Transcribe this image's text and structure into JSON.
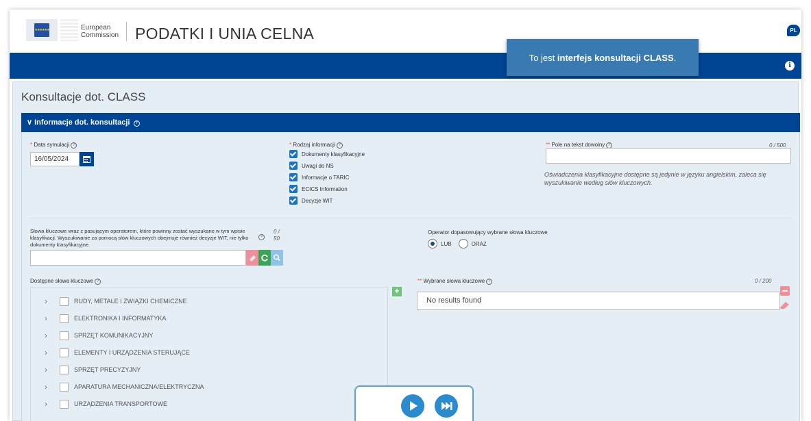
{
  "header": {
    "ec_line1": "European",
    "ec_line2": "Commission",
    "site_title": "PODATKI I UNIA CELNA",
    "lang": "PL",
    "info_icon": "info-icon"
  },
  "tooltip": {
    "prefix": "To jest ",
    "bold": "interfejs konsultacji CLASS",
    "suffix": "."
  },
  "page": {
    "title": "Konsultacje dot. CLASS",
    "section_title": "Informacje dot. konsultacji"
  },
  "form": {
    "date_label": "Data symulacji",
    "date_value": "16/05/2024",
    "info_type_label": "Rodzaj informacji",
    "info_types": [
      {
        "label": "Dokumenty klasyfikacyjne",
        "checked": true
      },
      {
        "label": "Uwagi do NS",
        "checked": true
      },
      {
        "label": "Informacje o TARIC",
        "checked": true
      },
      {
        "label": "ECICS Information",
        "checked": true
      },
      {
        "label": "Decyzje WIT",
        "checked": true
      }
    ],
    "free_text_label": "Pole na tekst dowolny",
    "free_text_counter": "0 / 500",
    "free_text_hint": "Oświadczenia klasyfikacyjne dostępne są jedynie w języku angielskim, zaleca się wyszukiwanie według słów kluczowych.",
    "keywords_label": "Słowa kluczowe wraz z pasującym operatorem, które powinny zostać wyszukane w tym wpisie klasyfikacji. Wyszukiwanie za pomocą słów kluczowych obejmuje również decyzje WIT, nie tylko dokumenty klasyfikacyjne.",
    "keywords_counter_top": "0 /",
    "keywords_counter_bottom": "50",
    "operator_label": "Operator dopasowujący wybrane słowa kluczowe",
    "operator_options": [
      "LUB",
      "ORAZ"
    ],
    "operator_selected": "LUB",
    "available_label": "Dostępne słowa kluczowe",
    "available_keywords": [
      "RUDY, METALE I ZWIĄZKI CHEMICZNE",
      "ELEKTRONIKA I INFORMATYKA",
      "SPRZĘT KOMUNIKACYJNY",
      "ELEMENTY I URZĄDZENIA STERUJĄCE",
      "SPRZĘT PRECYZYJNY",
      "APARATURA MECHANICZNA/ELEKTRYCZNA",
      "URZĄDZENIA TRANSPORTOWE"
    ],
    "selected_label": "Wybrane słowa kluczowe",
    "selected_counter": "0 / 200",
    "selected_empty": "No results found"
  },
  "colors": {
    "brand_blue": "#004494",
    "panel_bg": "#e6eef5",
    "required": "#d9534f",
    "player_blue": "#2b8bcf"
  }
}
